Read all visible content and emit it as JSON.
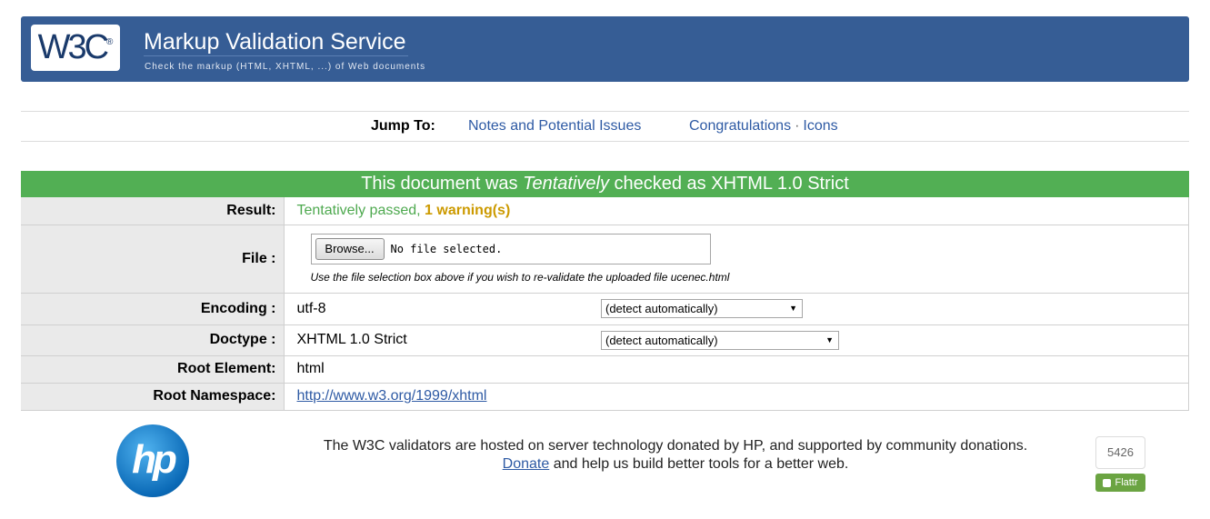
{
  "header": {
    "logo_text": "W3C",
    "logo_mark": "®",
    "title": "Markup Validation Service",
    "subtitle": "Check the markup (HTML, XHTML, ...) of Web documents"
  },
  "jump": {
    "label": "Jump To:",
    "notes": "Notes and Potential Issues",
    "congrats": "Congratulations",
    "separator": "·",
    "icons": "Icons"
  },
  "result_header": {
    "prefix": "This document was ",
    "emphasis": "Tentatively",
    "suffix": " checked as XHTML 1.0 Strict"
  },
  "rows": {
    "result": {
      "label": "Result:",
      "pass_text": "Tentatively passed, ",
      "warning_text": "1 warning(s)"
    },
    "file": {
      "label": "File :",
      "browse_label": "Browse...",
      "status": "No file selected.",
      "help": "Use the file selection box above if you wish to re-validate the uploaded file ucenec.html"
    },
    "encoding": {
      "label": "Encoding :",
      "value": "utf-8",
      "select_value": "(detect automatically)"
    },
    "doctype": {
      "label": "Doctype :",
      "value": "XHTML 1.0 Strict",
      "select_value": "(detect automatically)"
    },
    "root_element": {
      "label": "Root Element:",
      "value": "html"
    },
    "root_namespace": {
      "label": "Root Namespace:",
      "value": "http://www.w3.org/1999/xhtml"
    }
  },
  "footer": {
    "hp_logo_text": "hp",
    "line1": "The W3C validators are hosted on server technology donated by HP, and supported by community donations.",
    "donate_link": "Donate",
    "line2_rest": " and help us build better tools for a better web.",
    "flattr_count": "5426",
    "flattr_label": "Flattr"
  },
  "colors": {
    "banner": "#365d95",
    "success": "#52af54",
    "warning": "#cc9a00",
    "link": "#2e5aa4"
  }
}
